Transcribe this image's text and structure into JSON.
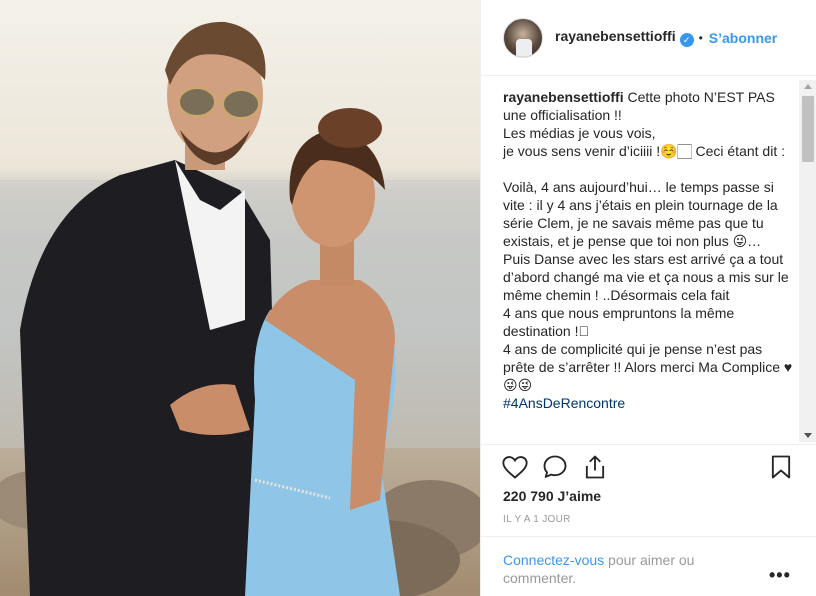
{
  "post": {
    "username": "rayanebensettioffi",
    "follow_label": "S’abonner",
    "separator": "•",
    "caption_username": "rayanebensettioffi",
    "caption_text": " Cette photo N’EST PAS une officialisation !!\nLes médias je vous vois,\nje vous sens venir d’iciiii !☺️🏻 Ceci étant dit :\n\nVoilà, 4 ans aujourd’hui… le temps passe si vite : il y 4 ans j’étais en plein tournage de la série Clem, je ne savais même pas que tu existais, et je pense que toi non plus 😜…\nPuis Danse avec les stars est arrivé ça a tout d’abord changé ma vie et ça nous a mis sur le même chemin ! ..Désormais cela fait\n4 ans que nous empruntons la même destination !🏻\n4 ans de complicité qui je pense n’est pas prête de s’arrêter !! Alors merci Ma Complice ♥\n😜😜",
    "hashtag": "#4AnsDeRencontre",
    "likes": "220 790 J’aime",
    "time_ago": "IL Y A 1 JOUR",
    "comment_login_link": "Connectez-vous",
    "comment_login_text": " pour aimer ou commenter.",
    "more_label": "•••"
  },
  "icons": {
    "like": "heart-outline-icon",
    "comment": "speech-bubble-icon",
    "share": "share-upload-icon",
    "save": "bookmark-icon",
    "verified": "verified-badge-icon",
    "more": "ellipsis-icon"
  },
  "colors": {
    "link_blue": "#3897f0",
    "hashtag": "#003569",
    "text": "#262626",
    "muted": "#999999",
    "border": "#efefef"
  }
}
